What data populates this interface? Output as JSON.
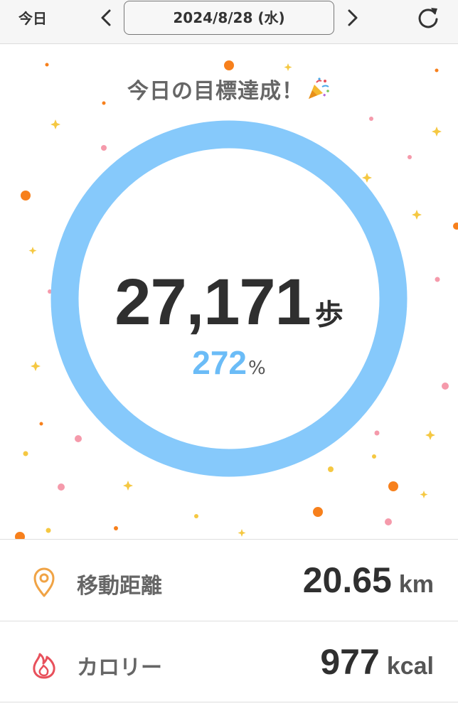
{
  "header": {
    "today_label": "今日",
    "date": "2024/8/28 (水)",
    "prev_icon": "chevron-left-icon",
    "next_icon": "chevron-right-icon",
    "refresh_icon": "refresh-icon"
  },
  "goal": {
    "title": "今日の目標達成！",
    "celebration_icon": "party-popper-icon",
    "steps": "27,171",
    "steps_unit": "歩",
    "percent": "272",
    "percent_unit": "%",
    "progress_fraction": 1.0
  },
  "stats": {
    "distance": {
      "icon": "location-pin-icon",
      "label": "移動距離",
      "value": "20.65",
      "unit": "km"
    },
    "calories": {
      "icon": "flame-icon",
      "label": "カロリー",
      "value": "977",
      "unit": "kcal"
    }
  },
  "colors": {
    "ring": "#86c9fb",
    "percent": "#6bbcf7",
    "distance_icon": "#f0a345",
    "calorie_icon": "#e8505b",
    "confetti_orange": "#f7801c",
    "confetti_pink": "#f59aab",
    "confetti_yellow": "#f5c842"
  }
}
